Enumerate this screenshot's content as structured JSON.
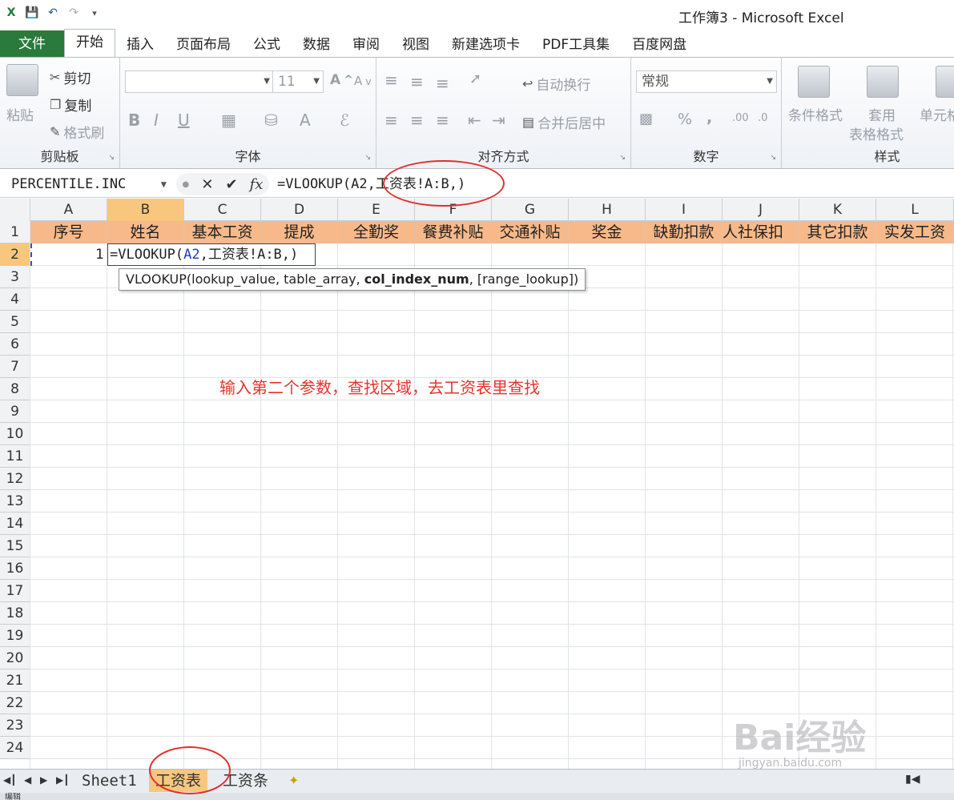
{
  "window": {
    "title": "工作簿3 - Microsoft Excel"
  },
  "tabs": [
    "文件",
    "开始",
    "插入",
    "页面布局",
    "公式",
    "数据",
    "审阅",
    "视图",
    "新建选项卡",
    "PDF工具集",
    "百度网盘"
  ],
  "ribbon": {
    "clipboard": {
      "paste": "粘贴",
      "cut": "剪切",
      "copy": "复制",
      "format_painter": "格式刷",
      "label": "剪贴板"
    },
    "font": {
      "size": "11",
      "label": "字体"
    },
    "alignment": {
      "wrap": "自动换行",
      "merge": "合并后居中",
      "label": "对齐方式"
    },
    "number": {
      "format": "常规",
      "label": "数字"
    },
    "styles": {
      "conditional": "条件格式",
      "table_top": "套用",
      "table_bottom": "表格格式",
      "cell": "单元格",
      "label": "样式"
    }
  },
  "formula_bar": {
    "name_box": "PERCENTILE.INC",
    "formula": "=VLOOKUP(A2,工资表!A:B,)"
  },
  "columns": [
    "A",
    "B",
    "C",
    "D",
    "E",
    "F",
    "G",
    "H",
    "I",
    "J",
    "K",
    "L"
  ],
  "header_row": [
    "序号",
    "姓名",
    "基本工资",
    "提成",
    "全勤奖",
    "餐费补贴",
    "交通补贴",
    "奖金",
    "缺勤扣款",
    "人社保扣",
    "其它扣款",
    "实发工资"
  ],
  "rows": [
    "1",
    "2",
    "3",
    "4",
    "5",
    "6",
    "7",
    "8",
    "9",
    "10",
    "11",
    "12",
    "13",
    "14",
    "15",
    "16",
    "17",
    "18",
    "19",
    "20",
    "21",
    "22",
    "23",
    "24"
  ],
  "cell_A2": "1",
  "editing": {
    "prefix": "=VLOOKUP(",
    "ref": "A2",
    "rest": ",工资表!A:B,)"
  },
  "tooltip": {
    "fn": "VLOOKUP(lookup_value, table_array, ",
    "current": "col_index_num",
    "tail": ", [range_lookup])"
  },
  "annotation": "输入第二个参数，查找区域，去工资表里查找",
  "sheets": [
    "Sheet1",
    "工资表",
    "工资条"
  ],
  "status": "编辑",
  "watermark": {
    "main": "Bai经验",
    "sub": "jingyan.baidu.com"
  }
}
